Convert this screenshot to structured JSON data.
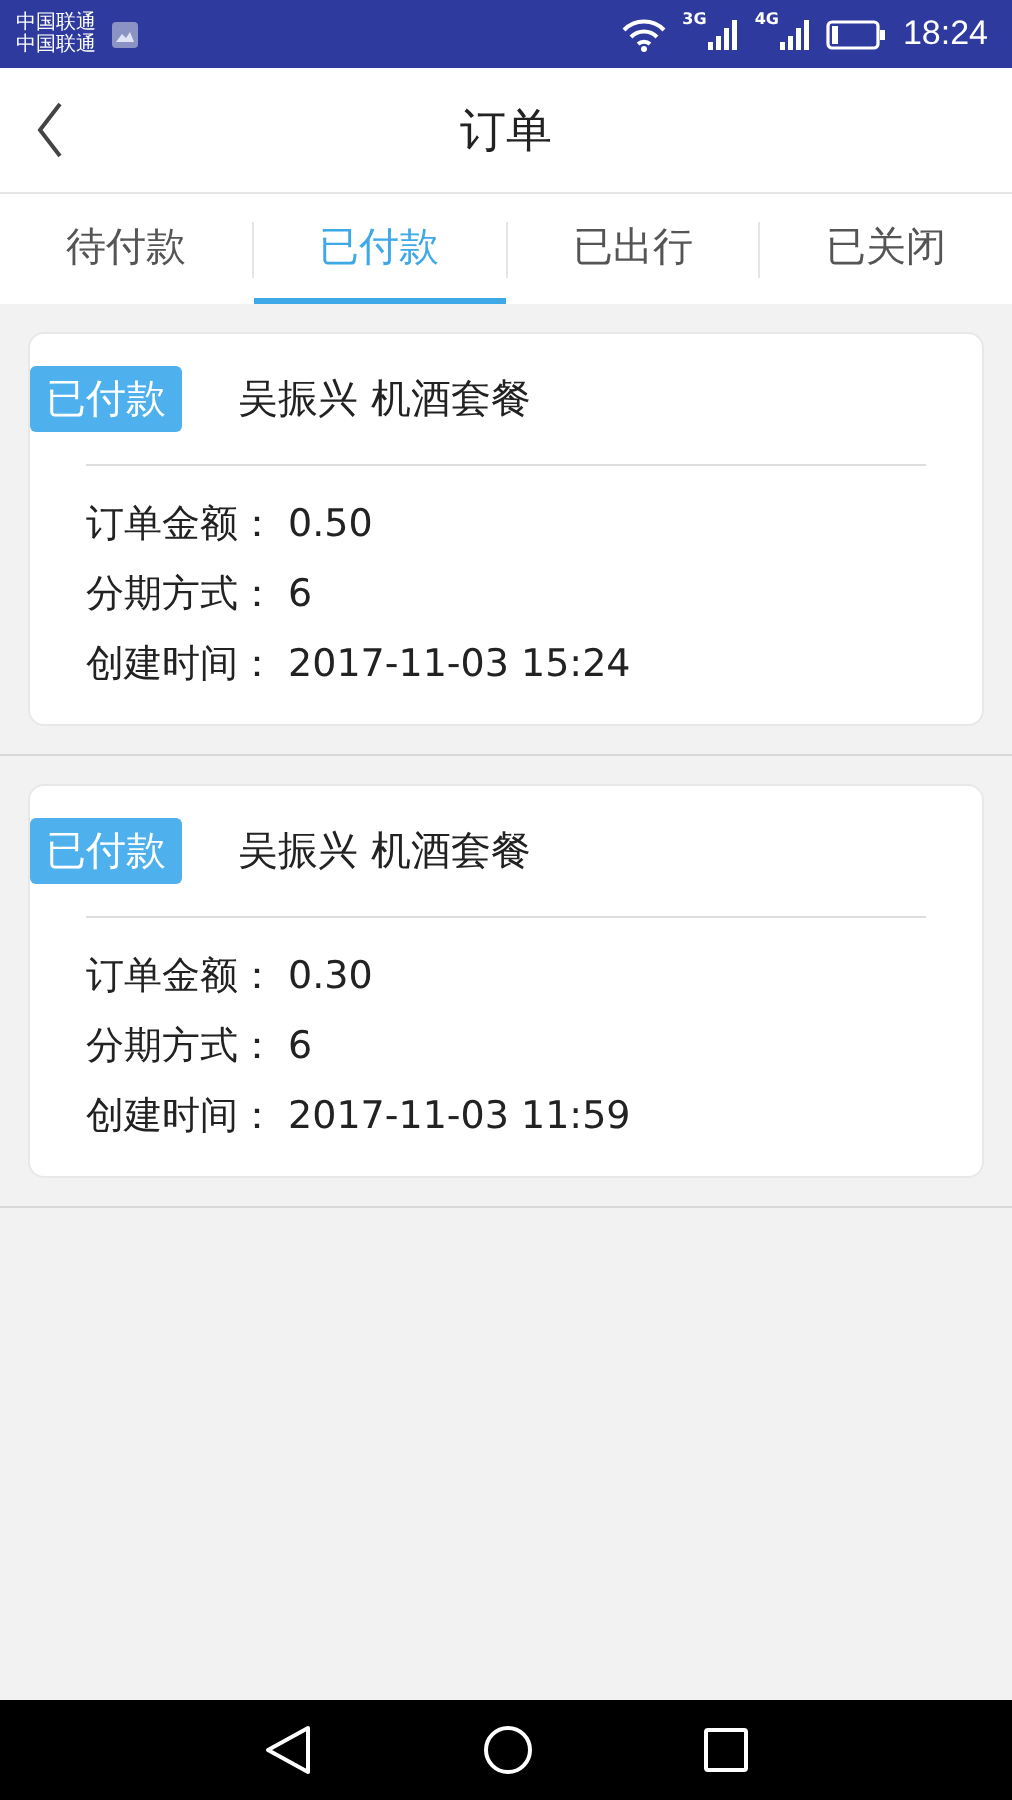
{
  "status_bar": {
    "carriers": [
      "中国联通",
      "中国联通"
    ],
    "network_labels": [
      "3G",
      "4G"
    ],
    "time": "18:24"
  },
  "header": {
    "title": "订单"
  },
  "tabs": [
    {
      "label": "待付款",
      "selected": false
    },
    {
      "label": "已付款",
      "selected": true
    },
    {
      "label": "已出行",
      "selected": false
    },
    {
      "label": "已关闭",
      "selected": false
    }
  ],
  "orders": [
    {
      "badge": "已付款",
      "title": "吴振兴 机酒套餐",
      "fields": [
        {
          "label": "订单金额：",
          "value": "0.50"
        },
        {
          "label": "分期方式：",
          "value": "6"
        },
        {
          "label": "创建时间：",
          "value": "2017-11-03 15:24"
        }
      ]
    },
    {
      "badge": "已付款",
      "title": "吴振兴 机酒套餐",
      "fields": [
        {
          "label": "订单金额：",
          "value": "0.30"
        },
        {
          "label": "分期方式：",
          "value": "6"
        },
        {
          "label": "创建时间：",
          "value": "2017-11-03 11:59"
        }
      ]
    }
  ]
}
